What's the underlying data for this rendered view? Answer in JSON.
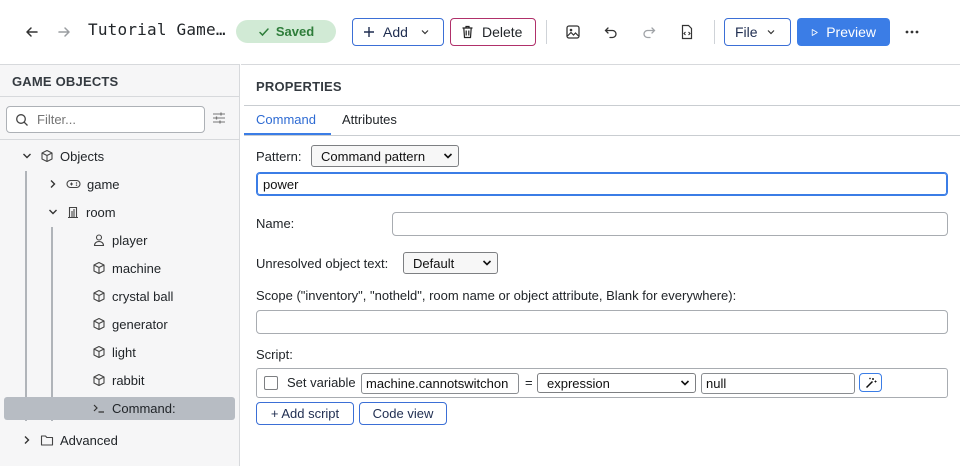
{
  "toolbar": {
    "back_icon": "arrow-left-icon",
    "forward_icon": "arrow-right-icon",
    "title": "Tutorial Game…",
    "saved_label": "Saved",
    "add_label": "Add",
    "delete_label": "Delete",
    "file_label": "File",
    "preview_label": "Preview"
  },
  "sidebar": {
    "title": "GAME OBJECTS",
    "filter_placeholder": "Filter...",
    "tree": {
      "objects_label": "Objects",
      "game_label": "game",
      "room_label": "room",
      "items": [
        "player",
        "machine",
        "crystal ball",
        "generator",
        "light",
        "rabbit",
        "Command:"
      ],
      "advanced_label": "Advanced"
    }
  },
  "properties": {
    "title": "PROPERTIES",
    "tabs": [
      "Command",
      "Attributes"
    ],
    "active_tab": "Command",
    "pattern_label": "Pattern:",
    "pattern_value": "Command pattern",
    "pattern_text": "power",
    "name_label": "Name:",
    "name_value": "",
    "unresolved_label": "Unresolved object text:",
    "unresolved_value": "Default",
    "scope_label": "Scope (\"inventory\", \"notheld\", room name or object attribute, Blank for everywhere):",
    "scope_value": "",
    "script_label": "Script:",
    "script": {
      "set_variable_label": "Set variable",
      "variable_name": "machine.cannotswitchon",
      "equals": "=",
      "type_value": "expression",
      "expression_value": "null"
    },
    "add_script_label": "+ Add script",
    "code_view_label": "Code view"
  },
  "colors": {
    "accent": "#3b7de6",
    "saved_bg": "#d1ead5",
    "saved_text": "#2e7d3a",
    "delete_border": "#b0306a",
    "selected_row": "#b7bcc3"
  }
}
